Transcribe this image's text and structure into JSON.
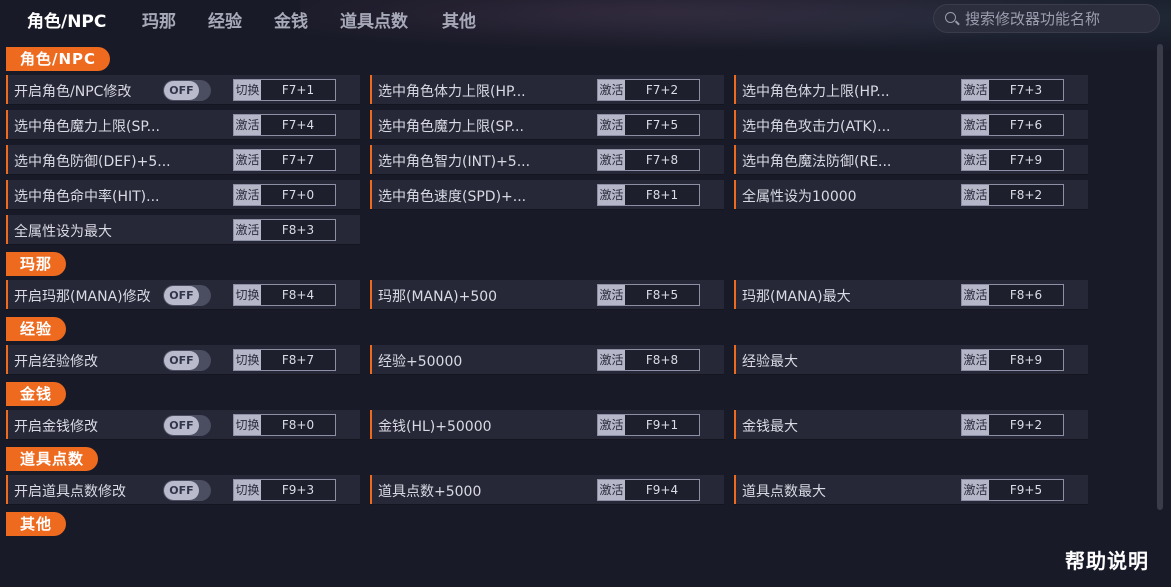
{
  "nav": {
    "tabs": [
      {
        "label": "角色/NPC",
        "active": true
      },
      {
        "label": "玛那",
        "active": false
      },
      {
        "label": "经验",
        "active": false
      },
      {
        "label": "金钱",
        "active": false
      },
      {
        "label": "道具点数",
        "active": false
      },
      {
        "label": "其他",
        "active": false
      }
    ],
    "search_placeholder": "搜索修改器功能名称"
  },
  "sections": {
    "role": {
      "title": "角色/NPC",
      "items": [
        {
          "label": "开启角色/NPC修改",
          "toggle": "OFF",
          "action": "切换",
          "hotkey": "F7+1"
        },
        {
          "label": "选中角色体力上限(HP...",
          "action": "激活",
          "hotkey": "F7+2"
        },
        {
          "label": "选中角色体力上限(HP...",
          "action": "激活",
          "hotkey": "F7+3"
        },
        {
          "label": "选中角色魔力上限(SP...",
          "action": "激活",
          "hotkey": "F7+4"
        },
        {
          "label": "选中角色魔力上限(SP...",
          "action": "激活",
          "hotkey": "F7+5"
        },
        {
          "label": "选中角色攻击力(ATK)...",
          "action": "激活",
          "hotkey": "F7+6"
        },
        {
          "label": "选中角色防御(DEF)+5...",
          "action": "激活",
          "hotkey": "F7+7"
        },
        {
          "label": "选中角色智力(INT)+5...",
          "action": "激活",
          "hotkey": "F7+8"
        },
        {
          "label": "选中角色魔法防御(RE...",
          "action": "激活",
          "hotkey": "F7+9"
        },
        {
          "label": "选中角色命中率(HIT)...",
          "action": "激活",
          "hotkey": "F7+0"
        },
        {
          "label": "选中角色速度(SPD)+...",
          "action": "激活",
          "hotkey": "F8+1"
        },
        {
          "label": "全属性设为10000",
          "action": "激活",
          "hotkey": "F8+2"
        },
        {
          "label": "全属性设为最大",
          "action": "激活",
          "hotkey": "F8+3"
        }
      ]
    },
    "mana": {
      "title": "玛那",
      "items": [
        {
          "label": "开启玛那(MANA)修改",
          "toggle": "OFF",
          "action": "切换",
          "hotkey": "F8+4"
        },
        {
          "label": "玛那(MANA)+500",
          "action": "激活",
          "hotkey": "F8+5"
        },
        {
          "label": "玛那(MANA)最大",
          "action": "激活",
          "hotkey": "F8+6"
        }
      ]
    },
    "exp": {
      "title": "经验",
      "items": [
        {
          "label": "开启经验修改",
          "toggle": "OFF",
          "action": "切换",
          "hotkey": "F8+7"
        },
        {
          "label": "经验+50000",
          "action": "激活",
          "hotkey": "F8+8"
        },
        {
          "label": "经验最大",
          "action": "激活",
          "hotkey": "F8+9"
        }
      ]
    },
    "money": {
      "title": "金钱",
      "items": [
        {
          "label": "开启金钱修改",
          "toggle": "OFF",
          "action": "切换",
          "hotkey": "F8+0"
        },
        {
          "label": "金钱(HL)+50000",
          "action": "激活",
          "hotkey": "F9+1"
        },
        {
          "label": "金钱最大",
          "action": "激活",
          "hotkey": "F9+2"
        }
      ]
    },
    "items": {
      "title": "道具点数",
      "items": [
        {
          "label": "开启道具点数修改",
          "toggle": "OFF",
          "action": "切换",
          "hotkey": "F9+3"
        },
        {
          "label": "道具点数+5000",
          "action": "激活",
          "hotkey": "F9+4"
        },
        {
          "label": "道具点数最大",
          "action": "激活",
          "hotkey": "F9+5"
        }
      ]
    },
    "other": {
      "title": "其他"
    }
  },
  "help_label": "帮助说明",
  "colors": {
    "accent": "#ee6a1f",
    "background": "#181a27",
    "cell": "#262837"
  }
}
